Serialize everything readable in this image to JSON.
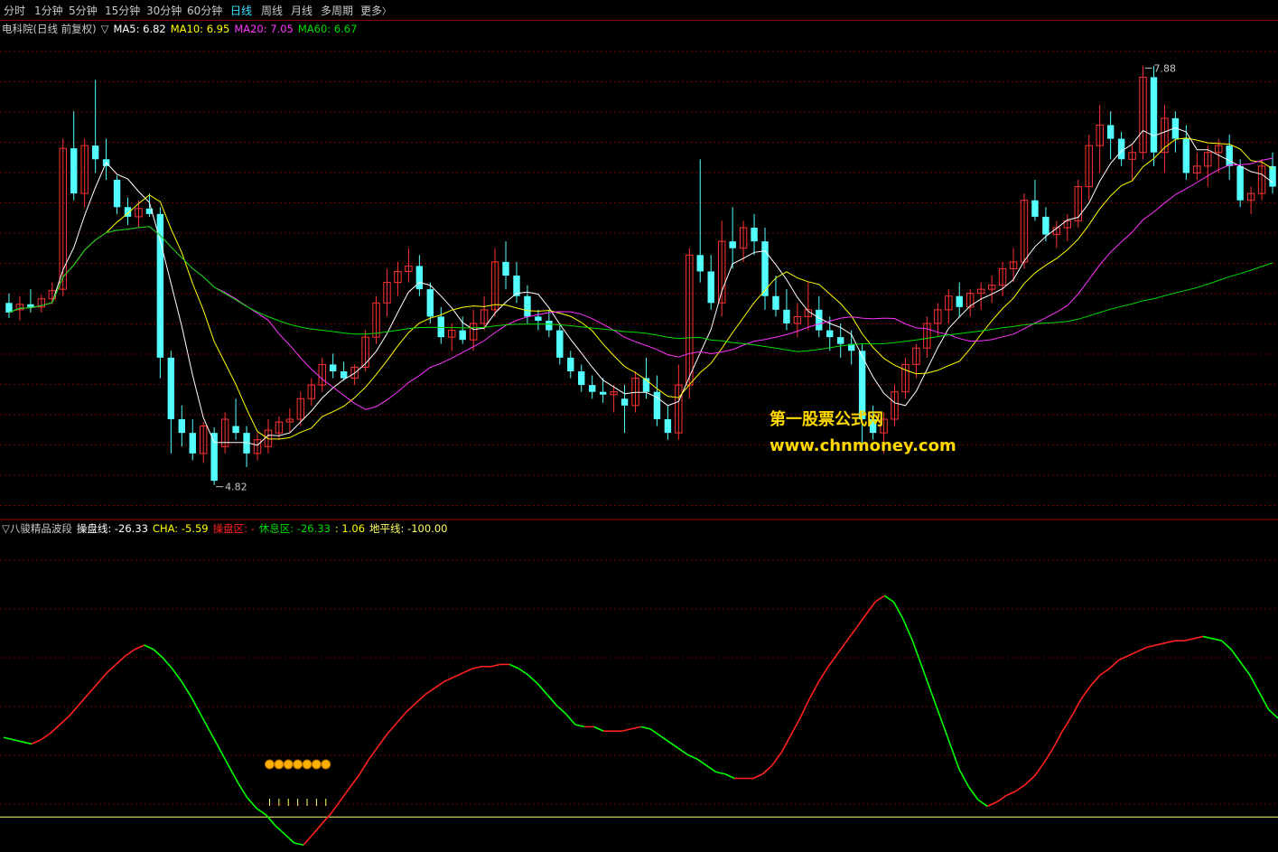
{
  "tabs": [
    {
      "label": "分时",
      "active": false
    },
    {
      "label": "1分钟",
      "active": false
    },
    {
      "label": "5分钟",
      "active": false
    },
    {
      "label": "15分钟",
      "active": false
    },
    {
      "label": "30分钟",
      "active": false
    },
    {
      "label": "60分钟",
      "active": false
    },
    {
      "label": "日线",
      "active": true
    },
    {
      "label": "周线",
      "active": false
    },
    {
      "label": "月线",
      "active": false
    },
    {
      "label": "多周期",
      "active": false
    },
    {
      "label": "更多",
      "active": false
    }
  ],
  "more_glyph": "〉",
  "main_info": {
    "title": "电科院(日线 前复权)",
    "toggle": "▽",
    "ma5": "MA5: 6.82",
    "ma10": "MA10: 6.95",
    "ma20": "MA20: 7.05",
    "ma60": "MA60: 6.67"
  },
  "sub_info": {
    "toggle": "▽",
    "name": "八骏精品波段",
    "line": "操盘线: -26.33",
    "cha": "CHA: -5.59",
    "op_zone": "操盘区: -",
    "rest_zone": "休息区: -26.33",
    "extra": ": 1.06",
    "horizon": "地平线: -100.00"
  },
  "watermark": {
    "name": "第一股票公式网",
    "url": "www.chnmoney.com"
  },
  "colors": {
    "up": "#ff3232",
    "down": "#54ffff",
    "ma5": "#ffffff",
    "ma10": "#ffff00",
    "ma20": "#ff33ff",
    "ma60": "#00dd00",
    "grid": "#7a0000",
    "op_line_up": "#ff2020",
    "op_line_down": "#00ff00",
    "horizon": "#ffff66",
    "money_bag": "#ffb000"
  },
  "chart_data": [
    {
      "type": "candlestick",
      "high_label": "7.88",
      "low_label": "4.82",
      "high_value": 7.88,
      "low_value": 4.82,
      "ylim": [
        4.6,
        8.1
      ],
      "ohlc": [
        [
          6.15,
          6.22,
          6.04,
          6.08
        ],
        [
          6.1,
          6.2,
          6.02,
          6.14
        ],
        [
          6.14,
          6.25,
          6.08,
          6.12
        ],
        [
          6.12,
          6.21,
          6.08,
          6.18
        ],
        [
          6.18,
          6.3,
          6.14,
          6.24
        ],
        [
          6.25,
          7.35,
          6.2,
          7.28
        ],
        [
          7.28,
          7.55,
          6.9,
          6.95
        ],
        [
          6.95,
          7.35,
          6.85,
          7.3
        ],
        [
          7.3,
          7.78,
          7.1,
          7.2
        ],
        [
          7.2,
          7.35,
          7.05,
          7.15
        ],
        [
          7.05,
          7.08,
          6.8,
          6.85
        ],
        [
          6.85,
          6.92,
          6.72,
          6.78
        ],
        [
          6.78,
          6.9,
          6.7,
          6.84
        ],
        [
          6.84,
          6.95,
          6.78,
          6.8
        ],
        [
          6.8,
          6.85,
          5.6,
          5.75
        ],
        [
          5.75,
          5.8,
          5.05,
          5.3
        ],
        [
          5.3,
          5.4,
          5.1,
          5.2
        ],
        [
          5.2,
          5.3,
          5.0,
          5.05
        ],
        [
          5.05,
          5.28,
          4.98,
          5.25
        ],
        [
          5.2,
          5.24,
          4.82,
          4.85
        ],
        [
          5.1,
          5.35,
          5.05,
          5.3
        ],
        [
          5.25,
          5.45,
          5.15,
          5.2
        ],
        [
          5.2,
          5.25,
          4.95,
          5.05
        ],
        [
          5.05,
          5.2,
          5.0,
          5.15
        ],
        [
          5.1,
          5.3,
          5.05,
          5.22
        ],
        [
          5.2,
          5.32,
          5.15,
          5.28
        ],
        [
          5.28,
          5.38,
          5.2,
          5.3
        ],
        [
          5.3,
          5.5,
          5.25,
          5.45
        ],
        [
          5.45,
          5.6,
          5.4,
          5.55
        ],
        [
          5.55,
          5.75,
          5.5,
          5.7
        ],
        [
          5.7,
          5.78,
          5.6,
          5.65
        ],
        [
          5.65,
          5.72,
          5.58,
          5.6
        ],
        [
          5.6,
          5.7,
          5.55,
          5.68
        ],
        [
          5.68,
          5.95,
          5.65,
          5.9
        ],
        [
          5.9,
          6.2,
          5.85,
          6.15
        ],
        [
          6.15,
          6.4,
          6.05,
          6.3
        ],
        [
          6.3,
          6.45,
          6.2,
          6.38
        ],
        [
          6.38,
          6.55,
          6.3,
          6.42
        ],
        [
          6.42,
          6.5,
          6.2,
          6.25
        ],
        [
          6.25,
          6.3,
          6.0,
          6.05
        ],
        [
          6.05,
          6.12,
          5.85,
          5.9
        ],
        [
          5.9,
          6.0,
          5.8,
          5.95
        ],
        [
          5.95,
          6.05,
          5.85,
          5.88
        ],
        [
          5.88,
          6.1,
          5.8,
          6.0
        ],
        [
          6.0,
          6.2,
          5.95,
          6.1
        ],
        [
          6.1,
          6.55,
          6.05,
          6.45
        ],
        [
          6.45,
          6.6,
          6.25,
          6.35
        ],
        [
          6.35,
          6.45,
          6.15,
          6.2
        ],
        [
          6.2,
          6.28,
          6.0,
          6.05
        ],
        [
          6.05,
          6.1,
          5.95,
          6.02
        ],
        [
          6.02,
          6.1,
          5.9,
          5.95
        ],
        [
          5.95,
          6.0,
          5.7,
          5.75
        ],
        [
          5.75,
          5.8,
          5.6,
          5.65
        ],
        [
          5.65,
          5.7,
          5.5,
          5.55
        ],
        [
          5.55,
          5.62,
          5.45,
          5.5
        ],
        [
          5.5,
          5.6,
          5.42,
          5.48
        ],
        [
          5.48,
          5.55,
          5.35,
          5.5
        ],
        [
          5.45,
          5.55,
          5.2,
          5.4
        ],
        [
          5.4,
          5.65,
          5.35,
          5.6
        ],
        [
          5.6,
          5.75,
          5.45,
          5.5
        ],
        [
          5.5,
          5.62,
          5.25,
          5.3
        ],
        [
          5.3,
          5.4,
          5.15,
          5.2
        ],
        [
          5.2,
          5.7,
          5.15,
          5.55
        ],
        [
          5.55,
          6.55,
          5.45,
          6.5
        ],
        [
          6.5,
          7.2,
          6.3,
          6.38
        ],
        [
          6.38,
          6.5,
          6.1,
          6.15
        ],
        [
          6.15,
          6.75,
          6.05,
          6.6
        ],
        [
          6.6,
          6.85,
          6.4,
          6.55
        ],
        [
          6.55,
          6.75,
          6.45,
          6.7
        ],
        [
          6.7,
          6.8,
          6.5,
          6.6
        ],
        [
          6.6,
          6.7,
          6.1,
          6.2
        ],
        [
          6.2,
          6.35,
          6.05,
          6.1
        ],
        [
          6.1,
          6.25,
          5.95,
          6.0
        ],
        [
          6.0,
          6.15,
          5.9,
          6.05
        ],
        [
          6.05,
          6.3,
          5.95,
          6.1
        ],
        [
          6.1,
          6.2,
          5.9,
          5.95
        ],
        [
          5.95,
          6.05,
          5.8,
          5.9
        ],
        [
          5.9,
          6.0,
          5.75,
          5.85
        ],
        [
          5.85,
          5.95,
          5.7,
          5.8
        ],
        [
          5.8,
          5.85,
          5.1,
          5.3
        ],
        [
          5.3,
          5.4,
          5.15,
          5.2
        ],
        [
          5.2,
          5.35,
          5.05,
          5.3
        ],
        [
          5.3,
          5.55,
          5.25,
          5.5
        ],
        [
          5.5,
          5.75,
          5.45,
          5.7
        ],
        [
          5.7,
          5.85,
          5.6,
          5.82
        ],
        [
          5.82,
          6.05,
          5.75,
          6.0
        ],
        [
          6.0,
          6.15,
          5.9,
          6.1
        ],
        [
          6.1,
          6.25,
          6.0,
          6.2
        ],
        [
          6.2,
          6.3,
          6.05,
          6.12
        ],
        [
          6.12,
          6.25,
          6.05,
          6.22
        ],
        [
          6.22,
          6.3,
          6.1,
          6.25
        ],
        [
          6.25,
          6.35,
          6.15,
          6.28
        ],
        [
          6.28,
          6.45,
          6.2,
          6.4
        ],
        [
          6.4,
          6.55,
          6.3,
          6.45
        ],
        [
          6.45,
          6.95,
          6.4,
          6.9
        ],
        [
          6.9,
          7.05,
          6.75,
          6.78
        ],
        [
          6.78,
          6.85,
          6.6,
          6.65
        ],
        [
          6.65,
          6.75,
          6.55,
          6.7
        ],
        [
          6.7,
          6.8,
          6.6,
          6.75
        ],
        [
          6.75,
          7.05,
          6.7,
          7.0
        ],
        [
          7.0,
          7.38,
          6.9,
          7.3
        ],
        [
          7.3,
          7.6,
          7.1,
          7.45
        ],
        [
          7.45,
          7.55,
          7.2,
          7.35
        ],
        [
          7.35,
          7.4,
          7.15,
          7.2
        ],
        [
          7.2,
          7.3,
          7.05,
          7.25
        ],
        [
          7.25,
          7.88,
          7.2,
          7.8
        ],
        [
          7.8,
          7.88,
          7.15,
          7.25
        ],
        [
          7.25,
          7.6,
          7.1,
          7.5
        ],
        [
          7.5,
          7.55,
          7.25,
          7.35
        ],
        [
          7.35,
          7.45,
          7.05,
          7.1
        ],
        [
          7.1,
          7.25,
          7.05,
          7.15
        ],
        [
          7.15,
          7.3,
          7.0,
          7.25
        ],
        [
          7.25,
          7.35,
          7.1,
          7.3
        ],
        [
          7.3,
          7.38,
          7.05,
          7.15
        ],
        [
          7.15,
          7.2,
          6.85,
          6.9
        ],
        [
          6.9,
          7.0,
          6.8,
          6.95
        ],
        [
          6.95,
          7.2,
          6.9,
          7.15
        ],
        [
          7.15,
          7.25,
          6.95,
          7.0
        ]
      ]
    },
    {
      "type": "line",
      "name": "操盘线",
      "ylim": [
        -115,
        30
      ],
      "horizon": -100,
      "values": [
        -63,
        -64,
        -65,
        -66,
        -64,
        -61,
        -57,
        -53,
        -48,
        -43,
        -38,
        -33,
        -29,
        -25,
        -22,
        -20,
        -22,
        -26,
        -31,
        -37,
        -44,
        -52,
        -60,
        -68,
        -76,
        -84,
        -91,
        -96,
        -99,
        -104,
        -108,
        -112,
        -113,
        -108,
        -103,
        -98,
        -92,
        -86,
        -80,
        -73,
        -67,
        -61,
        -56,
        -51,
        -47,
        -43,
        -40,
        -37,
        -35,
        -33,
        -31,
        -30,
        -30,
        -29,
        -29,
        -31,
        -34,
        -38,
        -43,
        -48,
        -52,
        -57,
        -58,
        -58,
        -60,
        -60,
        -60,
        -59,
        -58,
        -59,
        -62,
        -65,
        -68,
        -71,
        -73,
        -76,
        -79,
        -80,
        -82,
        -82,
        -82,
        -80,
        -76,
        -70,
        -62,
        -54,
        -45,
        -37,
        -30,
        -24,
        -18,
        -12,
        -6,
        0,
        3,
        0,
        -8,
        -18,
        -30,
        -42,
        -54,
        -66,
        -78,
        -86,
        -92,
        -95,
        -93,
        -90,
        -88,
        -85,
        -81,
        -75,
        -68,
        -60,
        -53,
        -45,
        -39,
        -34,
        -31,
        -27,
        -25,
        -23,
        -21,
        -20,
        -19,
        -18,
        -18,
        -17,
        -16,
        -17,
        -18,
        -22,
        -28,
        -34,
        -42,
        -50,
        -54
      ],
      "money_bags": 7
    }
  ]
}
